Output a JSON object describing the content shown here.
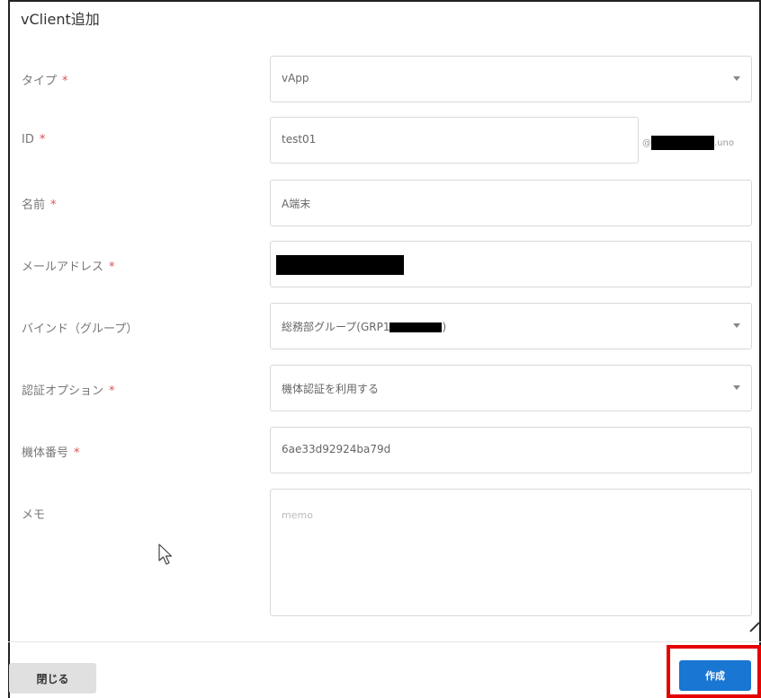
{
  "dialog": {
    "title": "vClient追加",
    "required_mark": "*"
  },
  "fields": {
    "type": {
      "label": "タイプ",
      "value": "vApp"
    },
    "id": {
      "label": "ID",
      "value": "test01",
      "suffix_prefix": "@",
      "suffix_end": ".uno"
    },
    "name": {
      "label": "名前",
      "value": "A端末"
    },
    "email": {
      "label": "メールアドレス",
      "value": ""
    },
    "bind": {
      "label": "バインド（グループ）",
      "value_prefix": "総務部グループ(GRP1",
      "value_suffix": ")"
    },
    "auth": {
      "label": "認証オプション",
      "value": "機体認証を利用する"
    },
    "serial": {
      "label": "機体番号",
      "value": "6ae33d92924ba79d"
    },
    "memo": {
      "label": "メモ",
      "placeholder": "memo"
    }
  },
  "footer": {
    "close_label": "閉じる",
    "create_label": "作成"
  },
  "colors": {
    "primary": "#1976d2",
    "required": "#e05050",
    "highlight": "#e60000"
  }
}
